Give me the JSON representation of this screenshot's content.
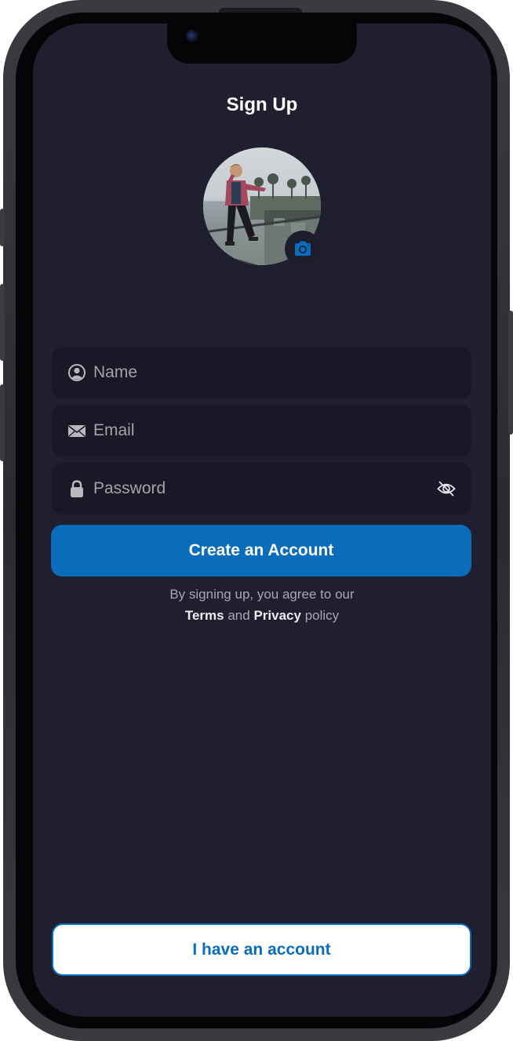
{
  "screen": {
    "title": "Sign Up"
  },
  "avatar": {
    "camera_icon": "camera-icon"
  },
  "form": {
    "name": {
      "value": "",
      "placeholder": "Name",
      "icon": "user-circle-icon"
    },
    "email": {
      "value": "",
      "placeholder": "Email",
      "icon": "envelope-icon"
    },
    "password": {
      "value": "",
      "placeholder": "Password",
      "icon": "lock-icon",
      "toggle_icon": "eye-slash-icon"
    }
  },
  "actions": {
    "create_label": "Create an Account",
    "login_label": "I have an account"
  },
  "terms": {
    "prefix": "By signing up, you agree to our",
    "terms_link": "Terms",
    "conjunction": "and",
    "privacy_link": "Privacy",
    "suffix": "policy"
  },
  "colors": {
    "background": "#201f30",
    "field": "#191826",
    "accent": "#0a6dbb",
    "text": "#ffffff",
    "muted": "#a7a7b0"
  }
}
